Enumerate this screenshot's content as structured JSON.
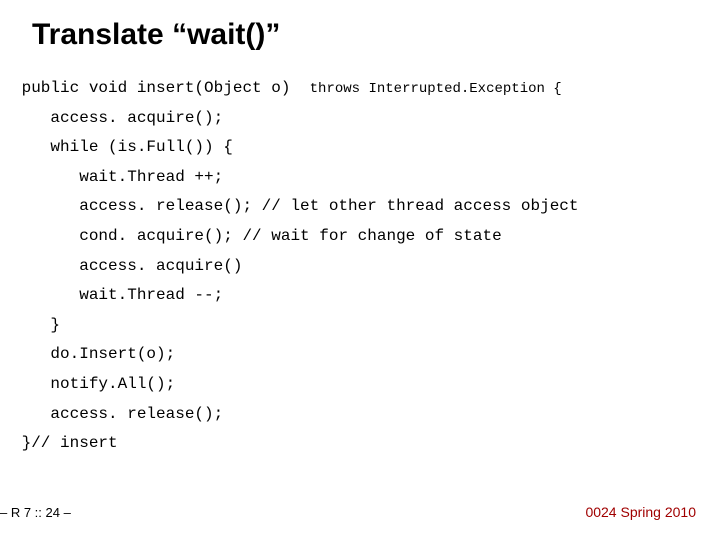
{
  "title": "Translate “wait()”",
  "code": {
    "l1a": " public void insert(Object o)  ",
    "l1b": "throws Interrupted.Exception {",
    "l2": "    access. acquire();",
    "l3": "    while (is.Full()) {",
    "l4": "       wait.Thread ++;",
    "l5": "       access. release(); // let other thread access object",
    "l6": "       cond. acquire(); // wait for change of state",
    "l7": "       access. acquire()",
    "l8": "       wait.Thread --;",
    "l9": "    }",
    "l10": "    do.Insert(o);",
    "l11": "    notify.All();",
    "l12": "    access. release();",
    "l13": " }// insert"
  },
  "footer": {
    "left": "– R 7 ::  24 –",
    "right": "0024 Spring 2010"
  }
}
